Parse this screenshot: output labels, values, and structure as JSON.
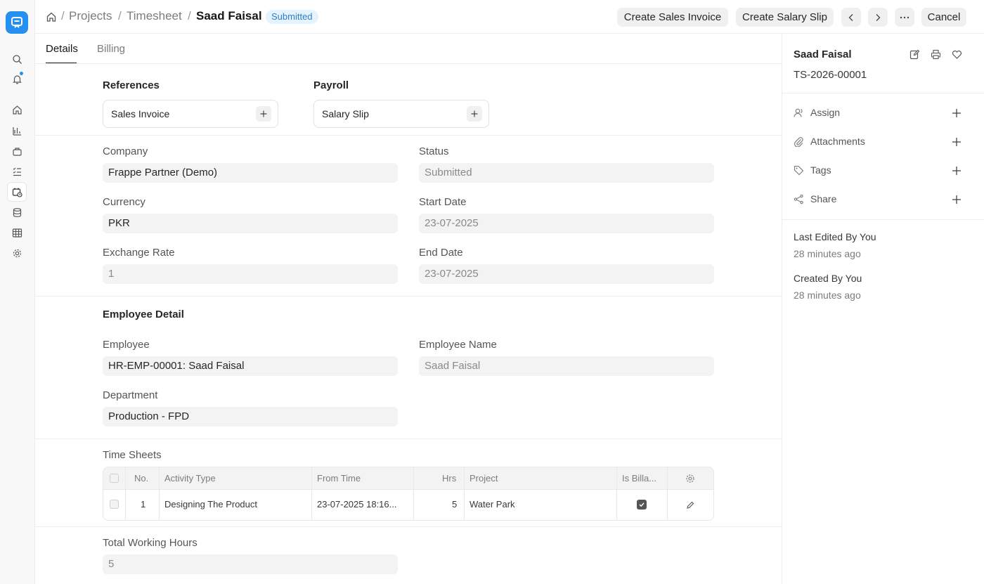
{
  "breadcrumb": {
    "items": [
      "Projects",
      "Timesheet"
    ],
    "current": "Saad Faisal",
    "status": "Submitted"
  },
  "header_actions": {
    "create_sales_invoice": "Create Sales Invoice",
    "create_salary_slip": "Create Salary Slip",
    "cancel": "Cancel"
  },
  "tabs": [
    {
      "label": "Details",
      "active": true
    },
    {
      "label": "Billing",
      "active": false
    }
  ],
  "references": {
    "title": "References",
    "link": "Sales Invoice"
  },
  "payroll": {
    "title": "Payroll",
    "link": "Salary Slip"
  },
  "fields": {
    "company": {
      "label": "Company",
      "value": "Frappe Partner (Demo)"
    },
    "status": {
      "label": "Status",
      "value": "Submitted"
    },
    "currency": {
      "label": "Currency",
      "value": "PKR"
    },
    "start_date": {
      "label": "Start Date",
      "value": "23-07-2025"
    },
    "exchange_rate": {
      "label": "Exchange Rate",
      "value": "1"
    },
    "end_date": {
      "label": "End Date",
      "value": "23-07-2025"
    }
  },
  "employee_detail": {
    "title": "Employee Detail",
    "employee": {
      "label": "Employee",
      "value": "HR-EMP-00001: Saad Faisal"
    },
    "employee_name": {
      "label": "Employee Name",
      "value": "Saad Faisal"
    },
    "department": {
      "label": "Department",
      "value": "Production - FPD"
    }
  },
  "time_sheets": {
    "title": "Time Sheets",
    "columns": [
      "No.",
      "Activity Type",
      "From Time",
      "Hrs",
      "Project",
      "Is Billa..."
    ],
    "rows": [
      {
        "no": "1",
        "activity_type": "Designing The Product",
        "from_time": "23-07-2025 18:16...",
        "hrs": "5",
        "project": "Water Park",
        "is_billable": true
      }
    ]
  },
  "total_working_hours": {
    "label": "Total Working Hours",
    "value": "5"
  },
  "sidebar": {
    "title": "Saad Faisal",
    "doc_id": "TS-2026-00001",
    "items": [
      {
        "label": "Assign",
        "icon": "user-icon"
      },
      {
        "label": "Attachments",
        "icon": "paperclip-icon"
      },
      {
        "label": "Tags",
        "icon": "tag-icon"
      },
      {
        "label": "Share",
        "icon": "share-icon"
      }
    ],
    "last_edited": "Last Edited By You",
    "last_edited_time": "28 minutes ago",
    "created": "Created By You",
    "created_time": "28 minutes ago"
  },
  "colors": {
    "accent": "#2490ef",
    "badge_bg": "#e6f3fd",
    "badge_text": "#2b7fcb"
  }
}
